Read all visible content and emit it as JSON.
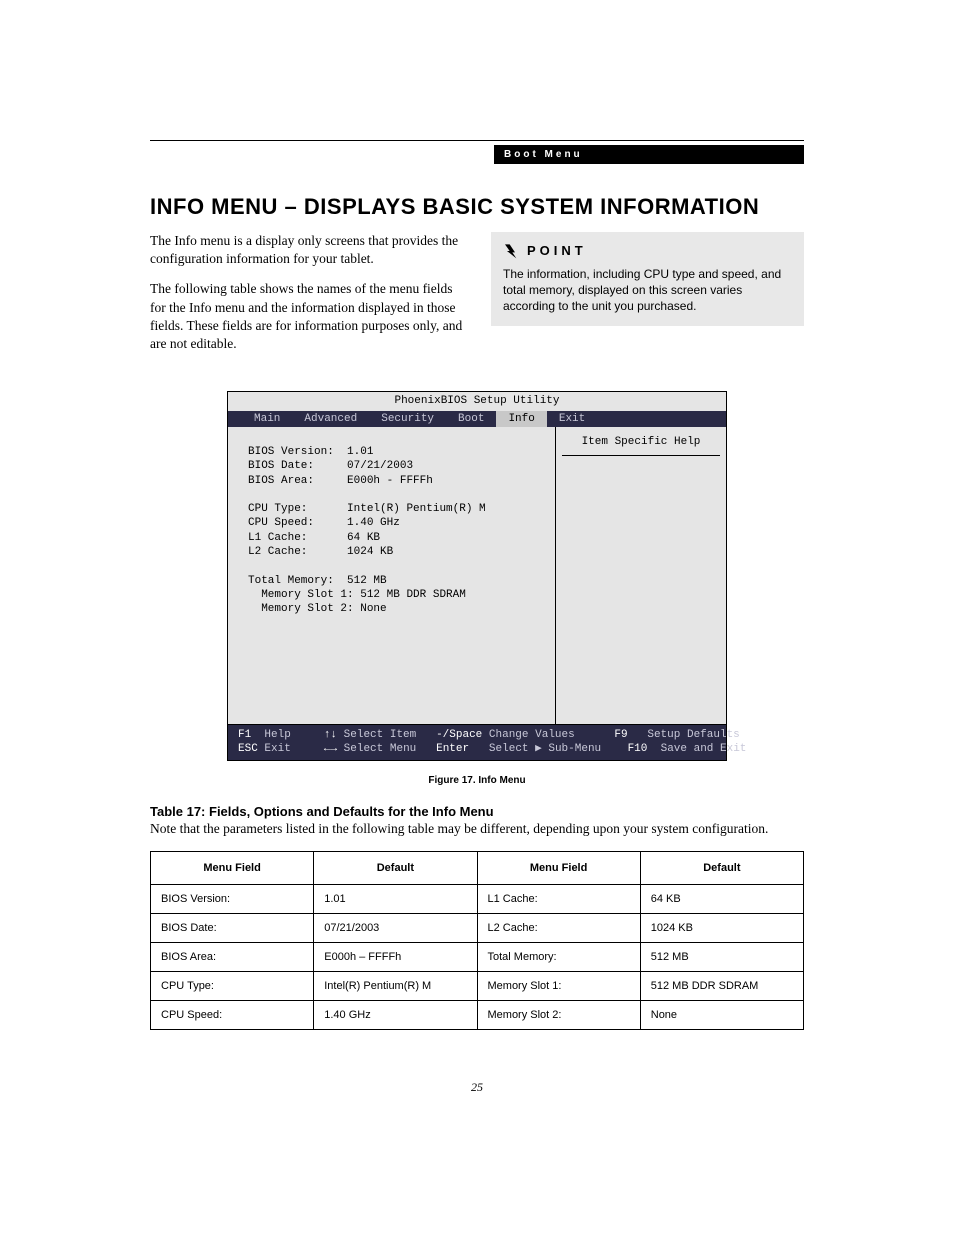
{
  "header": {
    "running_head": "Boot Menu"
  },
  "title": "INFO MENU – DISPLAYS BASIC SYSTEM INFORMATION",
  "intro": {
    "p1": "The Info menu is a display only screens that provides the configuration information for your tablet.",
    "p2": "The following table shows the names of the menu fields for the Info menu and the information displayed in those fields. These fields are for information purposes only, and are not editable."
  },
  "point": {
    "label": "POINT",
    "body": "The information, including CPU type and speed, and total memory, displayed on this screen varies according to the unit you purchased."
  },
  "bios": {
    "title": "PhoenixBIOS Setup Utility",
    "tabs": [
      "Main",
      "Advanced",
      "Security",
      "Boot",
      "Info",
      "Exit"
    ],
    "active_tab": "Info",
    "help_title": "Item Specific Help",
    "fields": {
      "bios_version_label": "BIOS Version:",
      "bios_version_value": "1.01",
      "bios_date_label": "BIOS Date:",
      "bios_date_value": "07/21/2003",
      "bios_area_label": "BIOS Area:",
      "bios_area_value": "E000h - FFFFh",
      "cpu_type_label": "CPU Type:",
      "cpu_type_value": "Intel(R) Pentium(R) M",
      "cpu_speed_label": "CPU Speed:",
      "cpu_speed_value": "1.40 GHz",
      "l1_label": "L1 Cache:",
      "l1_value": "64 KB",
      "l2_label": "L2 Cache:",
      "l2_value": "1024 KB",
      "total_mem_label": "Total Memory:",
      "total_mem_value": "512 MB",
      "slot1_label": "Memory Slot 1:",
      "slot1_value": "512 MB DDR SDRAM",
      "slot2_label": "Memory Slot 2:",
      "slot2_value": "None"
    },
    "footer": {
      "f1": "F1",
      "help": "Help",
      "updown": "↑↓",
      "select_item": "Select Item",
      "minus_space": "-/Space",
      "change_values": "Change Values",
      "f9": "F9",
      "setup_defaults": "Setup Defaults",
      "esc": "ESC",
      "exit": "Exit",
      "leftright": "←→",
      "select_menu": "Select Menu",
      "enter": "Enter",
      "select_sub": "Select ▶ Sub-Menu",
      "f10": "F10",
      "save_exit": "Save and Exit"
    }
  },
  "figure_caption": "Figure 17.   Info Menu",
  "table": {
    "title": "Table 17: Fields, Options and Defaults for the Info Menu",
    "note": "Note that the parameters listed in the following table may be different, depending upon your system configuration.",
    "headers": {
      "field": "Menu Field",
      "default": "Default"
    },
    "left_rows": [
      {
        "field": "BIOS Version:",
        "default": "1.01"
      },
      {
        "field": "BIOS Date:",
        "default": "07/21/2003"
      },
      {
        "field": "BIOS Area:",
        "default": "E000h – FFFFh"
      },
      {
        "field": "CPU Type:",
        "default": "Intel(R) Pentium(R) M"
      },
      {
        "field": "CPU Speed:",
        "default": "1.40 GHz"
      }
    ],
    "right_rows": [
      {
        "field": "L1 Cache:",
        "default": "64 KB"
      },
      {
        "field": "L2 Cache:",
        "default": "1024 KB"
      },
      {
        "field": "Total Memory:",
        "default": "512 MB"
      },
      {
        "field": "Memory Slot 1:",
        "default": "512 MB DDR SDRAM"
      },
      {
        "field": "Memory Slot 2:",
        "default": "None"
      }
    ]
  },
  "page_number": "25"
}
